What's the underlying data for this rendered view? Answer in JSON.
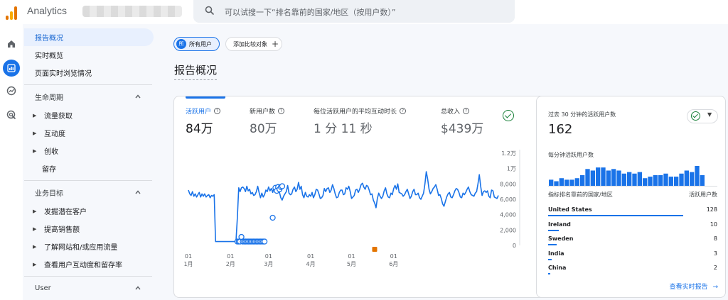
{
  "app": {
    "title": "Analytics"
  },
  "search": {
    "placeholder": "可以试搜一下“排名靠前的国家/地区（按用户数）”"
  },
  "nav": {
    "top_items": [
      "报告概况",
      "实时概览",
      "页面实时浏览情况"
    ],
    "sections": [
      {
        "title": "生命周期",
        "items": [
          "流量获取",
          "互动度",
          "创收"
        ],
        "leaf": "留存"
      },
      {
        "title": "业务目标",
        "items": [
          "发掘潜在客户",
          "提高销售额",
          "了解网站和/或应用流量",
          "查看用户互动度和留存率"
        ]
      },
      {
        "title": "User"
      }
    ]
  },
  "comparison": {
    "all_users_avatar": "所",
    "all_users": "所有用户",
    "add_compare": "添加比较对象"
  },
  "page_title": "报告概况",
  "kpis": [
    {
      "label": "活跃用户",
      "value": "84万"
    },
    {
      "label": "新用户数",
      "value": "80万"
    },
    {
      "label": "每位活跃用户的平均互动时长",
      "value": "1 分 11 秒"
    },
    {
      "label": "总收入",
      "value": "$439万"
    }
  ],
  "realtime": {
    "header": "过去 30 分钟的活跃用户数",
    "count": "162",
    "per_minute_label": "每分钟活跃用户数",
    "per_minute": [
      4,
      3,
      5,
      4,
      4,
      5,
      7,
      11,
      10,
      12,
      12,
      10,
      11,
      10,
      8,
      9,
      8,
      9,
      5,
      6,
      7,
      7,
      8,
      6,
      6,
      8,
      10,
      9,
      13,
      7
    ],
    "col_country": "指标排名靠前的国家/地区",
    "col_users": "活跃用户数",
    "rows": [
      {
        "country": "United States",
        "value": "128",
        "share": 1.0
      },
      {
        "country": "Ireland",
        "value": "10",
        "share": 0.08
      },
      {
        "country": "Sweden",
        "value": "8",
        "share": 0.065
      },
      {
        "country": "India",
        "value": "3",
        "share": 0.025
      },
      {
        "country": "China",
        "value": "2",
        "share": 0.015
      }
    ],
    "link": "查看实时报告"
  },
  "chart_data": {
    "type": "line",
    "title": "活跃用户",
    "x_ticks": [
      {
        "day": "01",
        "month": "1月"
      },
      {
        "day": "01",
        "month": "2月"
      },
      {
        "day": "01",
        "month": "3月"
      },
      {
        "day": "01",
        "month": "4月"
      },
      {
        "day": "01",
        "month": "5月"
      },
      {
        "day": "01",
        "month": "6月"
      }
    ],
    "y_ticks": [
      "1.2万",
      "1万",
      "8,000",
      "6,000",
      "4,000",
      "2,000",
      "0"
    ],
    "ylim": [
      0,
      12000
    ],
    "grid": false,
    "series": [
      {
        "color": "#1a73e8",
        "values": [
          7200,
          6700,
          6500,
          7000,
          6400,
          6700,
          6300,
          6600,
          6900,
          6300,
          6700,
          6400,
          6700,
          6300,
          6500,
          6600,
          6200,
          6500,
          6400,
          6600,
          500,
          500,
          500,
          500,
          500,
          500,
          500,
          500,
          500,
          500,
          500,
          500,
          500,
          500,
          500,
          500,
          3500,
          7500,
          7000,
          7500,
          7600,
          7400,
          7000,
          7700,
          7100,
          7300,
          6700,
          6900,
          6500,
          6600,
          7000,
          7700,
          6900,
          6200,
          6800,
          6300,
          6600,
          7200,
          7000,
          7600,
          7100,
          7400,
          6900,
          7600,
          7300,
          7400,
          7500,
          6900,
          6200,
          5900,
          6400,
          6700,
          7000,
          7800,
          6800,
          6600,
          6700,
          7300,
          7600,
          7000,
          7300,
          8200,
          7300,
          7700,
          6600,
          6200,
          6900,
          6400,
          6300,
          6600,
          6400,
          6900,
          6200,
          6600,
          7300,
          7200,
          6700,
          6100,
          6200,
          6500,
          7400,
          7000,
          7400,
          7500,
          6900,
          7200,
          7900,
          7400,
          6700,
          6200,
          6300,
          6900,
          7200,
          7200,
          6600,
          6700,
          7500,
          7300,
          7700,
          7000,
          6100,
          6300,
          6500,
          7200,
          7300,
          6900,
          7300,
          7900,
          8100,
          7600,
          7300,
          7800,
          7700,
          7200,
          6600,
          6700,
          5900,
          5500,
          4900,
          6100,
          6800,
          6400,
          6100,
          6400,
          7100,
          7500,
          6700,
          6300,
          6200,
          6800,
          6600,
          7400,
          7800,
          7300,
          8000,
          6900,
          6800,
          6700,
          6400,
          6600,
          7000,
          7300,
          6700,
          6100,
          6400,
          7000,
          7300,
          6600,
          6600,
          6800,
          6200,
          6000,
          6400,
          6800,
          8000,
          9600,
          8600,
          7300,
          6700,
          7000,
          7400,
          7600,
          7900,
          7300,
          6500,
          6600,
          6100,
          5400,
          5100,
          5700,
          6300,
          6700,
          6900,
          6300,
          6200,
          6600,
          7100,
          7400,
          7300,
          6900,
          6300,
          6200,
          6800,
          6600,
          6900,
          7300,
          7600,
          7000,
          6600,
          6500,
          6400,
          6800,
          7000,
          8000,
          9200,
          7700,
          6500,
          7000,
          7100,
          6900,
          7100,
          6400,
          6200,
          7200,
          7100,
          6300,
          6200,
          6100,
          6500
        ]
      }
    ],
    "markers": [
      {
        "x": 36,
        "y": 500
      },
      {
        "x": 37,
        "y": 500
      },
      {
        "x": 38,
        "y": 500
      },
      {
        "x": 39,
        "y": 1100
      },
      {
        "x": 40,
        "y": 500
      },
      {
        "x": 41,
        "y": 500
      },
      {
        "x": 42,
        "y": 500
      },
      {
        "x": 43,
        "y": 500
      },
      {
        "x": 44,
        "y": 500
      },
      {
        "x": 45,
        "y": 500
      },
      {
        "x": 46,
        "y": 500
      },
      {
        "x": 47,
        "y": 500
      },
      {
        "x": 48,
        "y": 500
      },
      {
        "x": 49,
        "y": 500
      },
      {
        "x": 50,
        "y": 500
      },
      {
        "x": 51,
        "y": 500
      },
      {
        "x": 52,
        "y": 500
      },
      {
        "x": 53,
        "y": 500
      },
      {
        "x": 54,
        "y": 500
      },
      {
        "x": 55,
        "y": 500
      },
      {
        "x": 56,
        "y": 500
      },
      {
        "x": 62,
        "y": 3600
      },
      {
        "x": 64,
        "y": 7500
      },
      {
        "x": 65,
        "y": 7100
      },
      {
        "x": 66,
        "y": 7600
      },
      {
        "x": 67,
        "y": 7300
      },
      {
        "x": 68,
        "y": 7600
      },
      {
        "x": 69,
        "y": 7700
      }
    ],
    "annotation_marker": {
      "x": 137,
      "color": "#e37400"
    }
  }
}
